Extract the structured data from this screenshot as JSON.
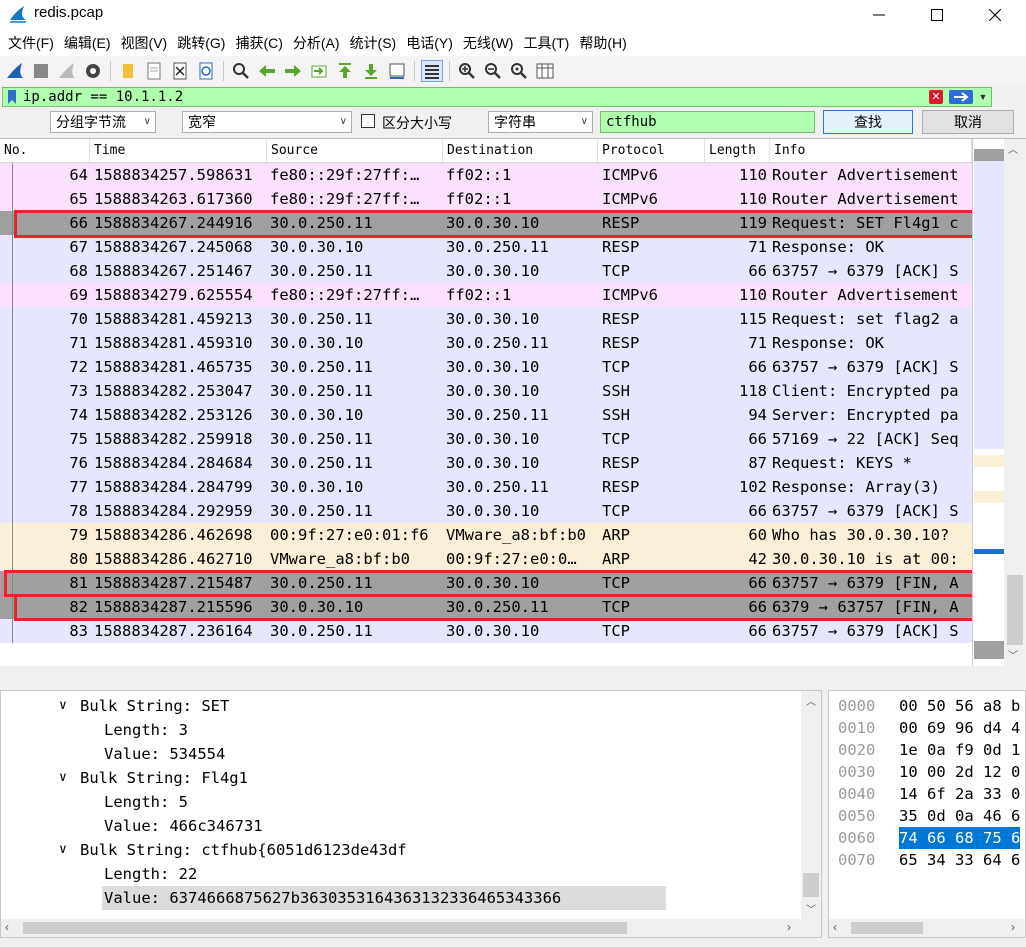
{
  "window": {
    "title": "redis.pcap"
  },
  "menu": [
    "文件(F)",
    "编辑(E)",
    "视图(V)",
    "跳转(G)",
    "捕获(C)",
    "分析(A)",
    "统计(S)",
    "电话(Y)",
    "无线(W)",
    "工具(T)",
    "帮助(H)"
  ],
  "filter": {
    "value": "ip.addr == 10.1.1.2"
  },
  "search": {
    "scope": "分组字节流",
    "charset": "宽窄",
    "case_label": "区分大小写",
    "type": "字符串",
    "query": "ctfhub",
    "find_label": "查找",
    "cancel_label": "取消"
  },
  "columns": [
    "No.",
    "Time",
    "Source",
    "Destination",
    "Protocol",
    "Length",
    "Info"
  ],
  "packets": [
    {
      "no": "64",
      "time": "1588834257.598631",
      "src": "fe80::29f:27ff:…",
      "dst": "ff02::1",
      "proto": "ICMPv6",
      "len": "110",
      "info": "Router Advertisement",
      "bg": "#fce0ff"
    },
    {
      "no": "65",
      "time": "1588834263.617360",
      "src": "fe80::29f:27ff:…",
      "dst": "ff02::1",
      "proto": "ICMPv6",
      "len": "110",
      "info": "Router Advertisement",
      "bg": "#fce0ff"
    },
    {
      "no": "66",
      "time": "1588834267.244916",
      "src": "30.0.250.11",
      "dst": "30.0.30.10",
      "proto": "RESP",
      "len": "119",
      "info": "Request: SET Fl4g1 c",
      "bg": "#a0a0a0"
    },
    {
      "no": "67",
      "time": "1588834267.245068",
      "src": "30.0.30.10",
      "dst": "30.0.250.11",
      "proto": "RESP",
      "len": "71",
      "info": "Response: OK",
      "bg": "#e7e6ff"
    },
    {
      "no": "68",
      "time": "1588834267.251467",
      "src": "30.0.250.11",
      "dst": "30.0.30.10",
      "proto": "TCP",
      "len": "66",
      "info": "63757 → 6379 [ACK] S",
      "bg": "#e7e6ff"
    },
    {
      "no": "69",
      "time": "1588834279.625554",
      "src": "fe80::29f:27ff:…",
      "dst": "ff02::1",
      "proto": "ICMPv6",
      "len": "110",
      "info": "Router Advertisement",
      "bg": "#fce0ff"
    },
    {
      "no": "70",
      "time": "1588834281.459213",
      "src": "30.0.250.11",
      "dst": "30.0.30.10",
      "proto": "RESP",
      "len": "115",
      "info": "Request: set flag2 a",
      "bg": "#e7e6ff"
    },
    {
      "no": "71",
      "time": "1588834281.459310",
      "src": "30.0.30.10",
      "dst": "30.0.250.11",
      "proto": "RESP",
      "len": "71",
      "info": "Response: OK",
      "bg": "#e7e6ff"
    },
    {
      "no": "72",
      "time": "1588834281.465735",
      "src": "30.0.250.11",
      "dst": "30.0.30.10",
      "proto": "TCP",
      "len": "66",
      "info": "63757 → 6379 [ACK] S",
      "bg": "#e7e6ff"
    },
    {
      "no": "73",
      "time": "1588834282.253047",
      "src": "30.0.250.11",
      "dst": "30.0.30.10",
      "proto": "SSH",
      "len": "118",
      "info": "Client: Encrypted pa",
      "bg": "#e7e6ff"
    },
    {
      "no": "74",
      "time": "1588834282.253126",
      "src": "30.0.30.10",
      "dst": "30.0.250.11",
      "proto": "SSH",
      "len": "94",
      "info": "Server: Encrypted pa",
      "bg": "#e7e6ff"
    },
    {
      "no": "75",
      "time": "1588834282.259918",
      "src": "30.0.250.11",
      "dst": "30.0.30.10",
      "proto": "TCP",
      "len": "66",
      "info": "57169 → 22 [ACK] Seq",
      "bg": "#e7e6ff"
    },
    {
      "no": "76",
      "time": "1588834284.284684",
      "src": "30.0.250.11",
      "dst": "30.0.30.10",
      "proto": "RESP",
      "len": "87",
      "info": "Request: KEYS *",
      "bg": "#e7e6ff"
    },
    {
      "no": "77",
      "time": "1588834284.284799",
      "src": "30.0.30.10",
      "dst": "30.0.250.11",
      "proto": "RESP",
      "len": "102",
      "info": "Response: Array(3)",
      "bg": "#e7e6ff"
    },
    {
      "no": "78",
      "time": "1588834284.292959",
      "src": "30.0.250.11",
      "dst": "30.0.30.10",
      "proto": "TCP",
      "len": "66",
      "info": "63757 → 6379 [ACK] S",
      "bg": "#e7e6ff"
    },
    {
      "no": "79",
      "time": "1588834286.462698",
      "src": "00:9f:27:e0:01:f6",
      "dst": "VMware_a8:bf:b0",
      "proto": "ARP",
      "len": "60",
      "info": "Who has 30.0.30.10?",
      "bg": "#faf0d7"
    },
    {
      "no": "80",
      "time": "1588834286.462710",
      "src": "VMware_a8:bf:b0",
      "dst": "00:9f:27:e0:0…",
      "proto": "ARP",
      "len": "42",
      "info": "30.0.30.10 is at 00:",
      "bg": "#faf0d7"
    },
    {
      "no": "81",
      "time": "1588834287.215487",
      "src": "30.0.250.11",
      "dst": "30.0.30.10",
      "proto": "TCP",
      "len": "66",
      "info": "63757 → 6379 [FIN, A",
      "bg": "#a0a0a0"
    },
    {
      "no": "82",
      "time": "1588834287.215596",
      "src": "30.0.30.10",
      "dst": "30.0.250.11",
      "proto": "TCP",
      "len": "66",
      "info": "6379 → 63757 [FIN, A",
      "bg": "#a0a0a0"
    },
    {
      "no": "83",
      "time": "1588834287.236164",
      "src": "30.0.250.11",
      "dst": "30.0.30.10",
      "proto": "TCP",
      "len": "66",
      "info": "63757 → 6379 [ACK] S",
      "bg": "#e7e6ff"
    }
  ],
  "details": [
    {
      "text": "Bulk String: SET",
      "level": 0,
      "expander": true
    },
    {
      "text": "Length: 3",
      "level": 1,
      "expander": false
    },
    {
      "text": "Value: 534554",
      "level": 1,
      "expander": false
    },
    {
      "text": "Bulk String: Fl4g1",
      "level": 0,
      "expander": true
    },
    {
      "text": "Length: 5",
      "level": 1,
      "expander": false
    },
    {
      "text": "Value: 466c346731",
      "level": 1,
      "expander": false
    },
    {
      "text": "Bulk String: ctfhub{6051d6123de43df",
      "level": 0,
      "expander": true
    },
    {
      "text": "Length: 22",
      "level": 1,
      "expander": false
    },
    {
      "text": "Value: 6374666875627b3630353164363132336465343366",
      "level": 1,
      "expander": false,
      "selected": true
    }
  ],
  "bytes": [
    {
      "offset": "0000",
      "hex": "00 50 56 a8 b"
    },
    {
      "offset": "0010",
      "hex": "00 69 96 d4 4"
    },
    {
      "offset": "0020",
      "hex": "1e 0a f9 0d 1"
    },
    {
      "offset": "0030",
      "hex": "10 00 2d 12 0"
    },
    {
      "offset": "0040",
      "hex": "14 6f 2a 33 0"
    },
    {
      "offset": "0050",
      "hex": "35 0d 0a 46 6"
    },
    {
      "offset": "0060",
      "hex": "74 66 68 75 6",
      "selected": true
    },
    {
      "offset": "0070",
      "hex": "65 34 33 64 6"
    }
  ],
  "colors": {
    "selected_bg": "#0078d7",
    "highlight_box": "#e8232a",
    "filter_bg": "#afffaf",
    "search_bg": "#afffaf"
  }
}
